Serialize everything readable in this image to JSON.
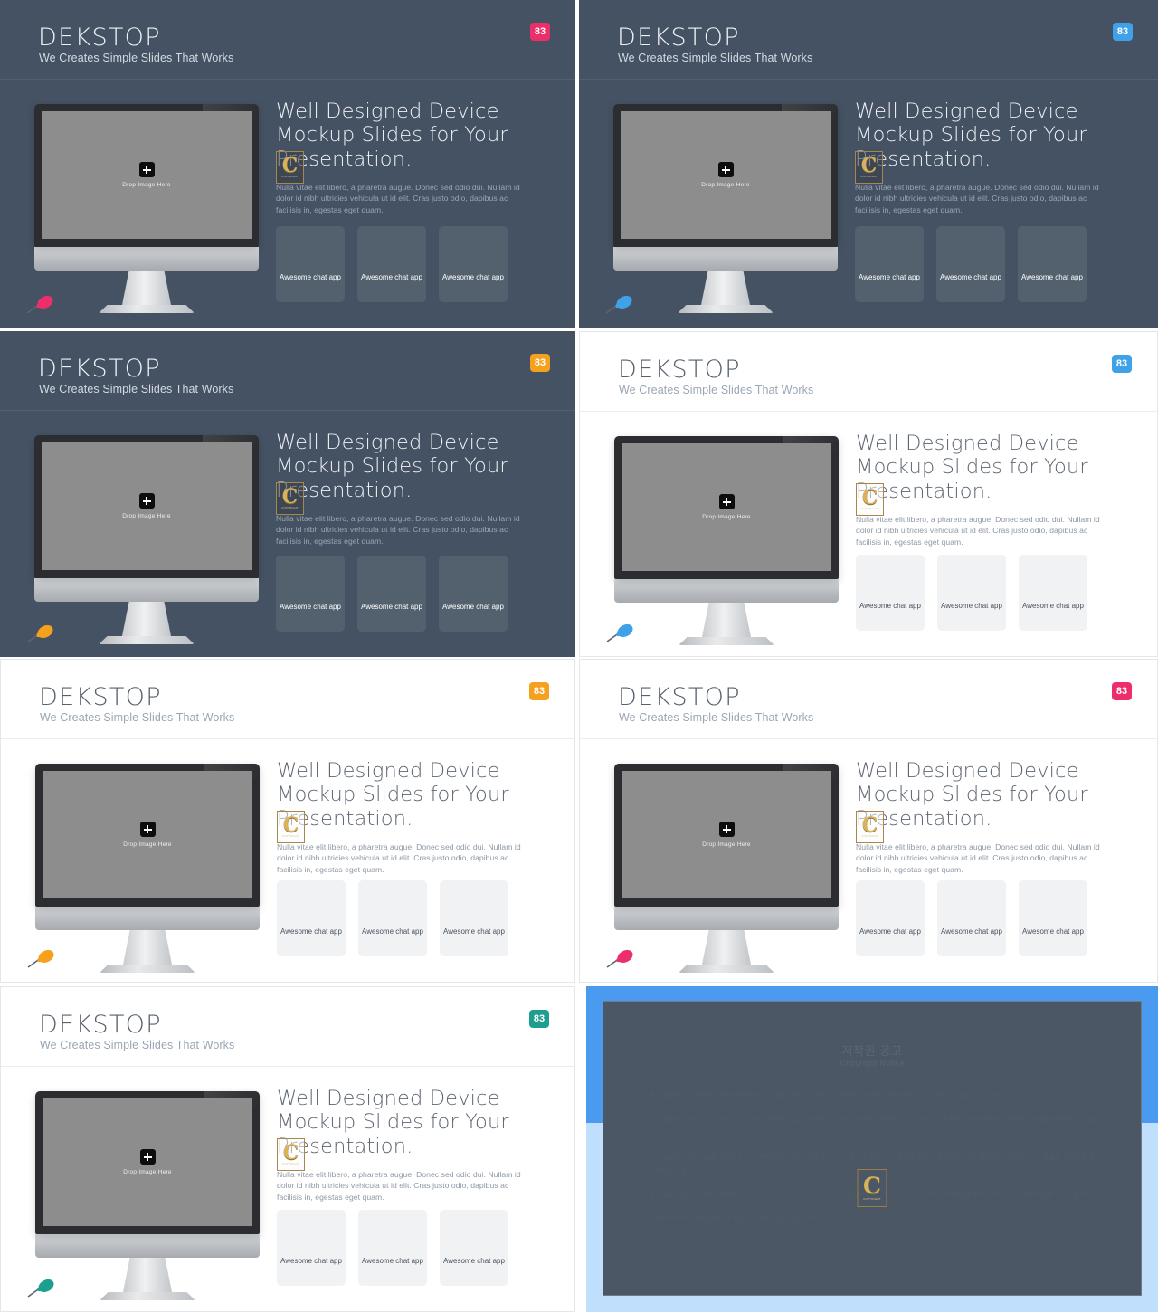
{
  "deck": {
    "slide_common": {
      "brand": "DEKSTOP",
      "tagline": "We Creates Simple Slides That Works",
      "badge_label": "83",
      "headline": "Well Designed Device Mockup Slides for Your Presentation.",
      "body_copy": "Nulla vitae elit libero, a pharetra augue. Donec sed odio dui. Nullam id dolor id nibh ultricies vehicula ut id elit. Cras justo odio, dapibus ac facilisis in, egestas eget quam.",
      "screen_placeholder": "Drop Image Here",
      "plus_icon": "plus-icon",
      "card_label": "Awesome chat app",
      "watermark": {
        "letter": "C",
        "sub": "COPYRIGHT"
      }
    },
    "slides": [
      {
        "id": 1,
        "theme": "dark",
        "accent": "#ec2e6b",
        "pin_color": "#ec2e6b",
        "pin_icon": "pushpin-icon"
      },
      {
        "id": 2,
        "theme": "dark",
        "accent": "#3fa2e8",
        "pin_color": "#3fa2e8",
        "pin_icon": "pushpin-icon"
      },
      {
        "id": 3,
        "theme": "dark",
        "accent": "#f5a11d",
        "pin_color": "#f5a11d",
        "pin_icon": "pushpin-icon"
      },
      {
        "id": 4,
        "theme": "light",
        "accent": "#3fa2e8",
        "pin_color": "#3fa2e8",
        "pin_icon": "pushpin-icon"
      },
      {
        "id": 5,
        "theme": "light",
        "accent": "#f5a11d",
        "pin_color": "#f5a11d",
        "pin_icon": "pushpin-icon"
      },
      {
        "id": 6,
        "theme": "light",
        "accent": "#ec2e6b",
        "pin_color": "#ec2e6b",
        "pin_icon": "pushpin-icon"
      },
      {
        "id": 7,
        "theme": "light",
        "accent": "#1d9e8e",
        "pin_color": "#1d9e8e",
        "pin_icon": "pushpin-icon"
      }
    ]
  },
  "copyright_panel": {
    "title_ko": "저작권 공고",
    "title_en": "Copyright Notice",
    "paragraphs": [
      "본 저작물은 저작권법에 의하여 보호받는 저작물이므로 무단 전재 및 복제를 금지하며, 이를 위반할 경우 법적 책임을 질 수 있습니다.",
      "본 템플릿에 사용된 모든 이미지와 아이콘, 서체는 상업적 사용이 허가된 자료이며, 구매자는 개인 및 상업적 목적의 프레젠테이션 제작에 자유롭게 사용할 수 있습니다.",
      "다만 템플릿 원본 파일을 재판매하거나 재배포하는 행위, 수정 후 유사 상품으로 판매하는 행위는 엄격히 금지되며 이에 대한 민사 및 형사상의 책임은 전적으로 위반자에게 있습니다.",
      "본 파일을 다운로드하여 사용하는 것으로 위의 조건에 동의한 것으로 간주합니다. 문의사항이 있으신 경우 고객센터를 통해 연락 주시면 신속히 답변 드리겠습니다.",
      "이용해 주셔서 감사합니다. 더 좋은 서비스로 보답하겠습니다."
    ],
    "logo": {
      "letter": "C",
      "sub": "COPYRIGHT"
    }
  }
}
